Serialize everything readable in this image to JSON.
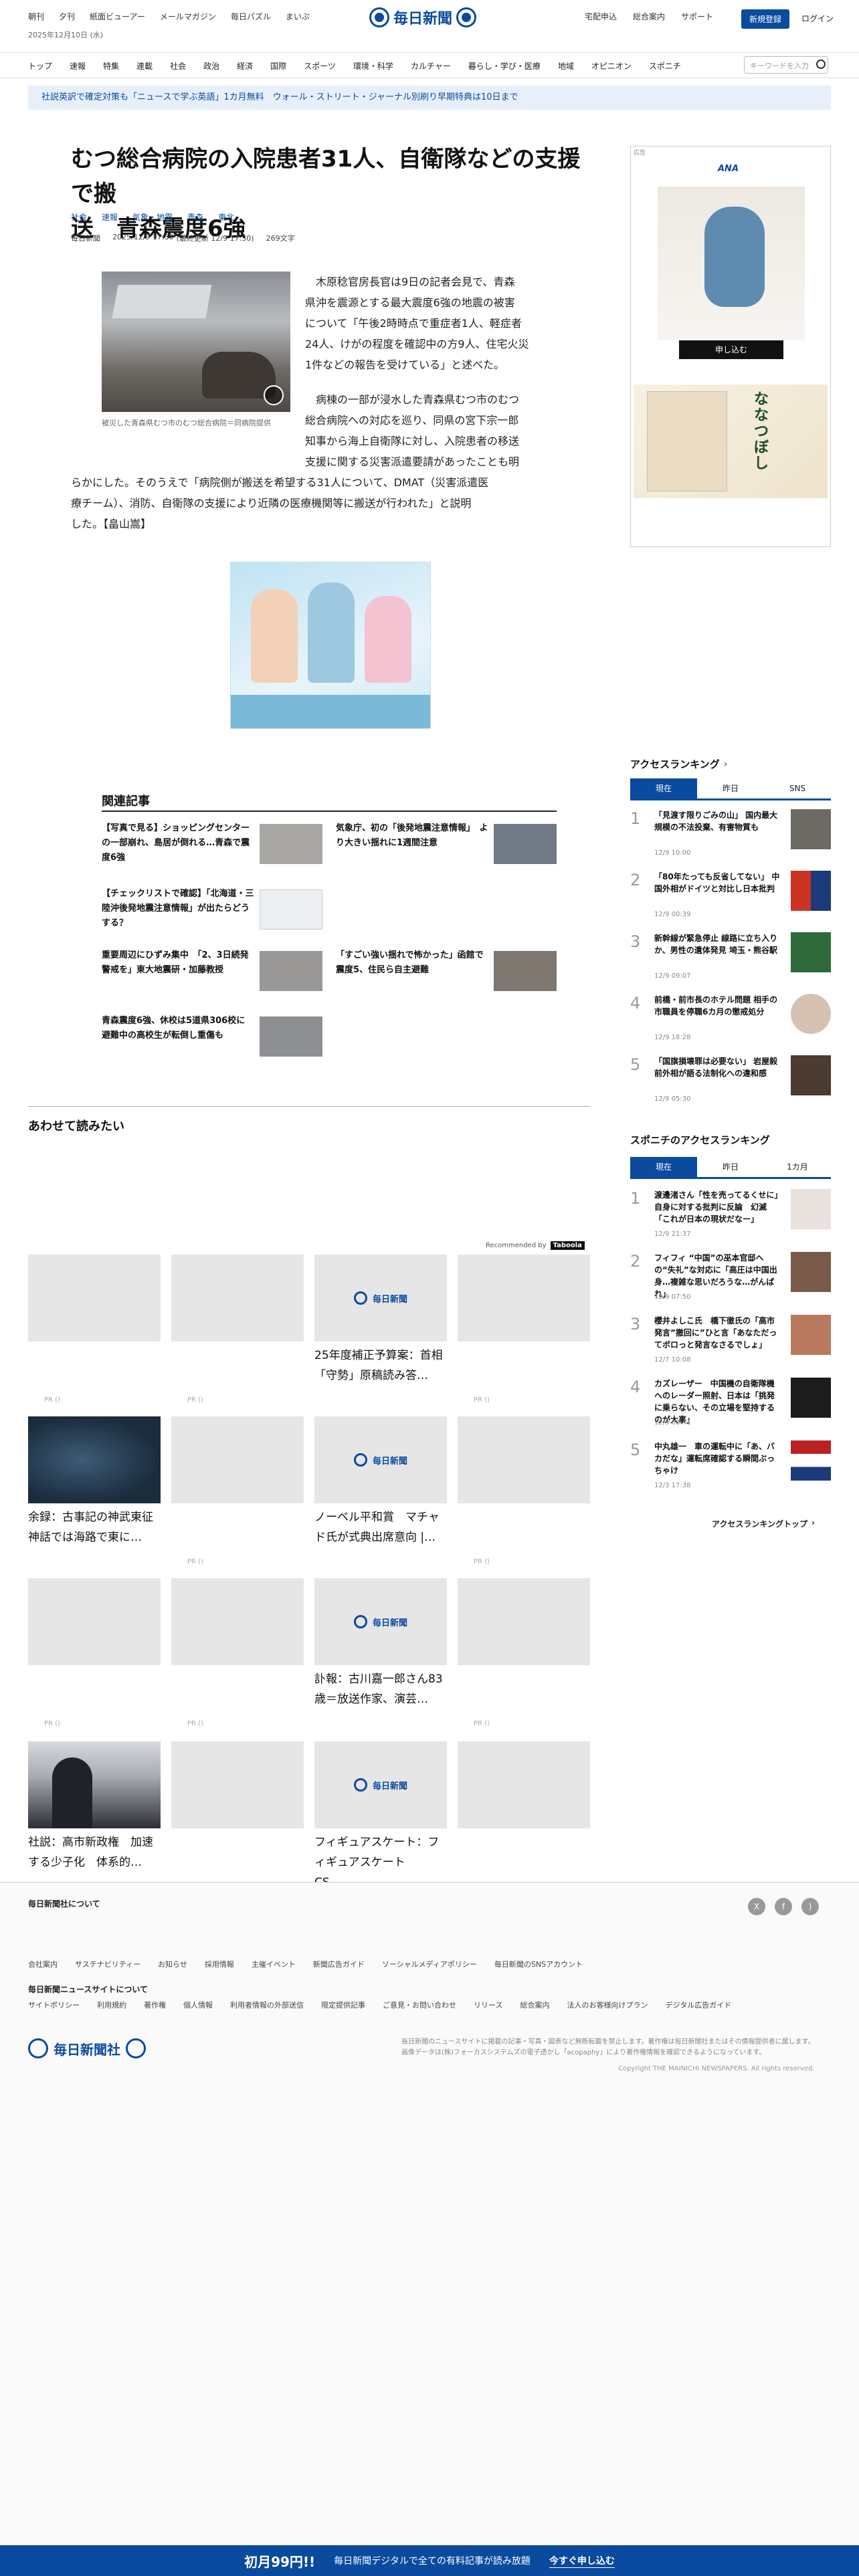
{
  "header": {
    "top_links": [
      "朝刊",
      "夕刊",
      "紙面ビューアー",
      "メールマガジン",
      "毎日パズル",
      "まいぷ"
    ],
    "date": "2025年12月10日 (水)",
    "logo_text": "毎日新聞",
    "right_links": [
      "宅配申込",
      "総合案内",
      "サポート"
    ],
    "register_label": "新規登録",
    "login_label": "ログイン"
  },
  "nav": {
    "items": [
      "トップ",
      "速報",
      "特集",
      "連載",
      "社会",
      "政治",
      "経済",
      "国際",
      "スポーツ",
      "環境・科学",
      "カルチャー",
      "暮らし・学び・医療",
      "地域",
      "オピニオン",
      "スポニチ"
    ],
    "search_placeholder": "キーワードを入力"
  },
  "promo_banner": "社説英訳で確定対策も「ニュースで学ぶ英語」1カ月無料　ウォール・ストリート・ジャーナル別刷り早期特典は10日まで",
  "article": {
    "title_line1": "むつ総合病院の入院患者31人、自衛隊などの支援で搬",
    "title_line2": "送　青森震度6強",
    "tags": [
      "社会",
      "速報",
      "気象・地震",
      "青森",
      "東北"
    ],
    "source": "毎日新聞",
    "published": "2025/12/9 17:30",
    "updated": "(最終更新 12/9 17:30)",
    "length": "269文字",
    "photo_caption": "被災した青森県むつ市のむつ総合病院＝同病院提供",
    "para1_lines": [
      "　木原稔官房長官は9日の記者会見で、青森",
      "県沖を震源とする最大震度6強の地震の被害",
      "について「午後2時時点で重症者1人、軽症者",
      "24人、けがの程度を確認中の方9人、住宅火災",
      "1件などの報告を受けている」と述べた。"
    ],
    "para2_lines": [
      "　病棟の一部が浸水した青森県むつ市のむつ",
      "総合病院への対応を巡り、同県の宮下宗一郎",
      "知事から海上自衛隊に対し、入院患者の移送",
      "支援に関する災害派遣要請があったことも明",
      "らかにした。そのうえで「病院側が搬送を希望する31人について、DMAT（災害派遣医",
      "療チーム）、消防、自衛隊の支援により近隣の医療機関等に搬送が行われた」と説明",
      "した。【畠山嵩】"
    ]
  },
  "ads": {
    "right_label": "広告",
    "ana_label": "ANA",
    "apply_label": "申し込む",
    "nanatsuboshi": "ななつぼし"
  },
  "related": {
    "title": "関連記事",
    "items": [
      "【写真で見る】ショッピングセンターの一部崩れ、島居が倒れる…青森で震度6強",
      "気象庁、初の「後発地震注意情報」　より大きい揺れに1週間注意",
      "【チェックリストで確認】「北海道・三陸沖後発地震注意情報」が出たらどうする？",
      "重要周辺にひずみ集中　「2、3日続発警戒を」東大地震研・加藤教授",
      "「すごい強い揺れで怖かった」函館で震度5、住民ら自主避難",
      "青森震度6強、休校は5道県306校に　避難中の高校生が転倒し重傷も"
    ]
  },
  "also_read": {
    "title": "あわせて読みたい",
    "recommended_by": "Recommended by",
    "taboola": "Taboola",
    "pr_label": "PR ()",
    "cards": [
      "25年度補正予算案：首相「守勢」原稿読み答…",
      "余録：古事記の神武東征神話では海路で東に…",
      "ノーベル平和賞　マチャド氏が式典出席意向 |…",
      "訃報：古川嘉一郎さん83歳＝放送作家、演芸…",
      "社説：高市新政権　加速する少子化　体系的…",
      "フィギュアスケート：フィギュアスケート　CS　…"
    ]
  },
  "ranking": {
    "title": "アクセスランキング",
    "tabs": [
      "現在",
      "昨日",
      "SNS"
    ],
    "items": [
      {
        "num": "1",
        "text": "「見渡す限りごみの山」 国内最大規模の不法投棄、有害物質も",
        "time": "12/9 10:00"
      },
      {
        "num": "2",
        "text": "「80年たっても反省してない」 中国外相がドイツと対比し日本批判",
        "time": "12/9 00:39"
      },
      {
        "num": "3",
        "text": "新幹線が緊急停止 線路に立ち入りか、男性の遺体発見 埼玉・熊谷駅",
        "time": "12/9 09:07"
      },
      {
        "num": "4",
        "text": "前橋・前市長のホテル問題 相手の市職員を停職6カ月の懲戒処分",
        "time": "12/9 18:28"
      },
      {
        "num": "5",
        "text": "「国旗損壊罪は必要ない」 岩屋毅前外相が語る法制化への違和感",
        "time": "12/9 05:30"
      }
    ]
  },
  "sponichi": {
    "title": "スポニチのアクセスランキング",
    "tabs": [
      "現在",
      "昨日",
      "1カ月"
    ],
    "items": [
      {
        "num": "1",
        "text": "渡邊渚さん「性を売ってるくせに」自身に対する批判に反論　幻滅「これが日本の現状だなー」",
        "time": "12/9 21:37"
      },
      {
        "num": "2",
        "text": "フィフィ “中国”の巫本官邸への“失礼”な対応に「高圧は中国出身…複雑な思いだろうな…がんばれ」",
        "time": "12/9 07:50"
      },
      {
        "num": "3",
        "text": "櫻井よしこ氏　橋下徹氏の「高市発言”撤回に”ひと言「あなただってボロっと発言なさるでしょ」",
        "time": "12/7 10:08"
      },
      {
        "num": "4",
        "text": "カズレーザー　中国機の自衛隊機へのレーダー照射、日本は「挑発に乗らない、その立場を堅持するのが大事」",
        "time": "12/9 08:41"
      },
      {
        "num": "5",
        "text": "中丸雄一　車の運転中に「あ、バカだな」運転席確認する瞬間ぶっちゃけ",
        "time": "12/3 17:38"
      }
    ],
    "more": "アクセスランキングトップ"
  },
  "footer": {
    "about_title": "毎日新聞社について",
    "about_links": [
      "会社案内",
      "サステナビリティー",
      "お知らせ",
      "採用情報",
      "主催イベント",
      "新聞広告ガイド",
      "ソーシャルメディアポリシー",
      "毎日新聞のSNSアカウント"
    ],
    "site_title": "毎日新聞ニュースサイトについて",
    "site_links": [
      "サイトポリシー",
      "利用規約",
      "著作権",
      "個人情報",
      "利用者情報の外部送信",
      "限定提供記事",
      "ご意見・お問い合わせ",
      "リリース",
      "総合案内",
      "法人のお客様向けプラン",
      "デジタル広告ガイド"
    ],
    "company_logo": "毎日新聞社",
    "notice": "毎日新聞のニュースサイトに掲載の記事・写真・図表など無断転載を禁止します。著作権は毎日新聞社またはその情報提供者に属します。",
    "notice2": "画像データは(株)フォーカスシステムズの電子透かし「acopaphy」により著作権情報を確認できるようになっています。",
    "copyright": "Copyright THE MAINICHI NEWSPAPERS. All rights reserved."
  },
  "bottom_bar": {
    "price": "初月99円!!",
    "text": "毎日新聞デジタルで全ての有料記事が読み放題",
    "cta": "今すぐ申し込む"
  },
  "colors": {
    "brand": "#0a4a9f",
    "banner_bg": "#e7f0fa"
  }
}
